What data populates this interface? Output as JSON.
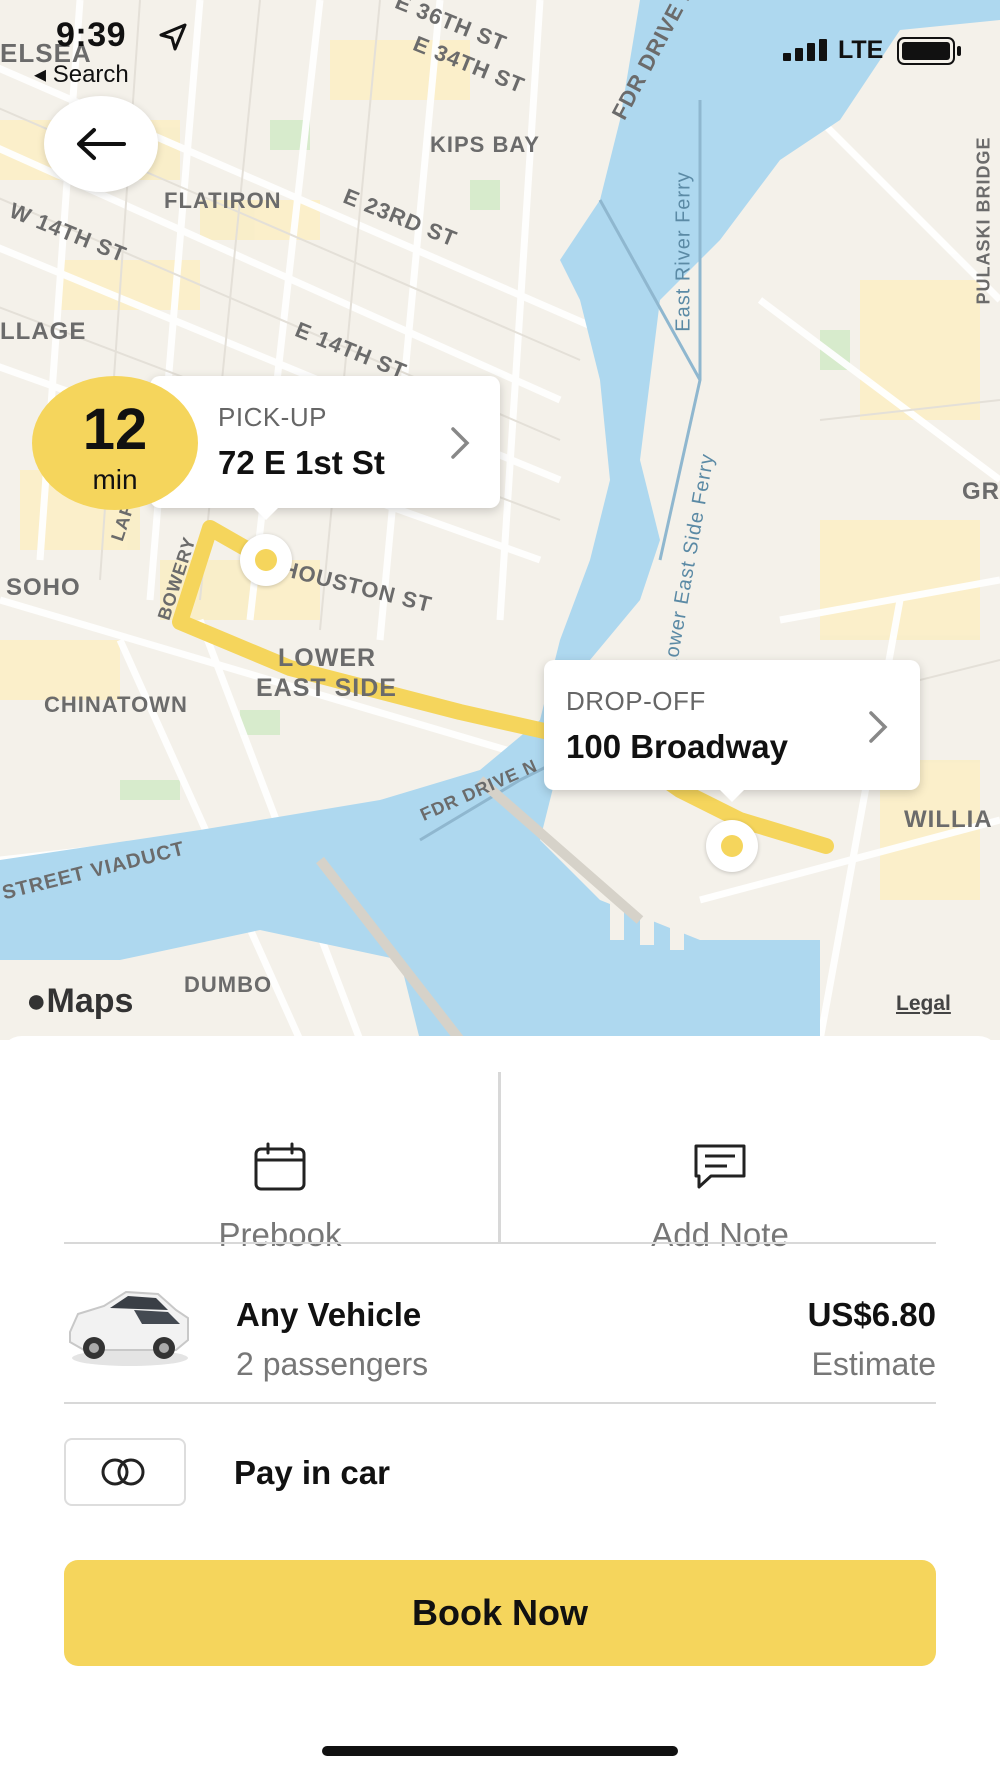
{
  "status_bar": {
    "time": "9:39",
    "back_app": "◂ Search",
    "network": "LTE"
  },
  "map": {
    "labels": {
      "chelsea": "ELSEA",
      "e36": "E 36TH ST",
      "e34": "E 34TH ST",
      "fdr_n": "FDR DRIVE N",
      "kips_bay": "KIPS BAY",
      "flatiron": "FLATIRON",
      "e23": "E 23RD ST",
      "w14": "W 14TH ST",
      "village": "LLAGE",
      "e14": "E 14TH ST",
      "east_river_ferry": "East River Ferry",
      "lower_es_ferry": "Lower East Side Ferry",
      "pulaski": "PULASKI BRIDGE",
      "gr": "GR",
      "soho": "SOHO",
      "bowery": "BOWERY",
      "lafayette": "LAF",
      "houston": "HOUSTON ST",
      "lower": "LOWER",
      "east_side": "EAST SIDE",
      "chinatown": "CHINATOWN",
      "fdr_drive": "FDR DRIVE N",
      "willia": "WILLIA",
      "viaduct": "STREET VIADUCT",
      "dumbo": "DUMBO"
    },
    "eta": {
      "value": "12",
      "unit": "min"
    },
    "pickup": {
      "caption": "PICK-UP",
      "address": "72 E 1st St"
    },
    "dropoff": {
      "caption": "DROP-OFF",
      "address": "100 Broadway"
    },
    "attribution": "Maps",
    "legal": "Legal",
    "colors": {
      "route": "#f5d55c",
      "water": "#aed8ef",
      "land": "#f4f1ea"
    }
  },
  "actions": {
    "prebook": {
      "label": "Prebook",
      "icon": "calendar-icon"
    },
    "add_note": {
      "label": "Add Note",
      "icon": "message-icon"
    }
  },
  "vehicle": {
    "name": "Any Vehicle",
    "passengers": "2 passengers",
    "price": "US$6.80",
    "price_note": "Estimate"
  },
  "payment": {
    "label": "Pay in car",
    "icon": "cash-icon"
  },
  "book_button": {
    "label": "Book Now"
  },
  "accent_color": "#f5d55c"
}
